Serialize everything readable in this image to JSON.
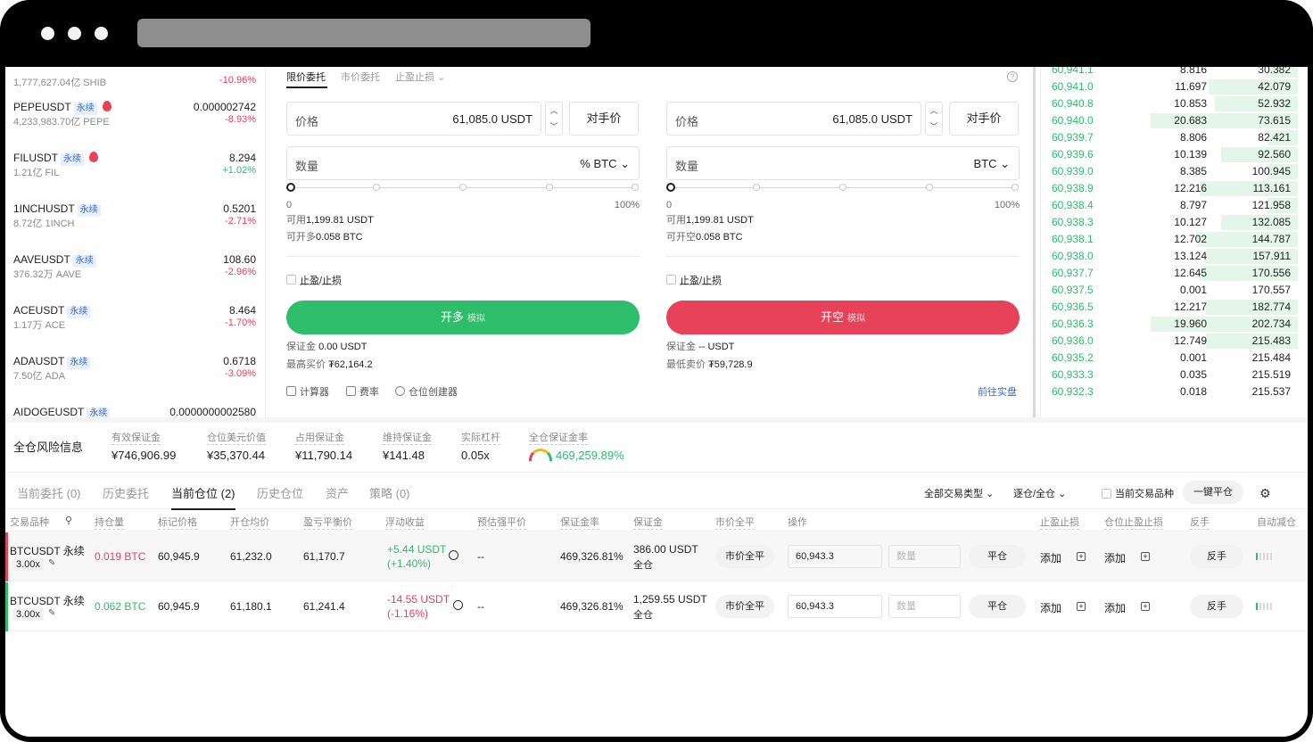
{
  "browser": {
    "dots": 3
  },
  "symbols": [
    {
      "name": "",
      "volume": "1,777,627.04亿 SHIB",
      "price": "",
      "change": "-10.96%",
      "dir": "down",
      "badge": "",
      "hot": false
    },
    {
      "name": "PEPEUSDT",
      "volume": "4,233,983.70亿 PEPE",
      "price": "0.000002742",
      "change": "-8.93%",
      "dir": "down",
      "badge": "永续",
      "hot": true
    },
    {
      "name": "FILUSDT",
      "volume": "1.21亿 FIL",
      "price": "8.294",
      "change": "+1.02%",
      "dir": "up",
      "badge": "永续",
      "hot": true
    },
    {
      "name": "1INCHUSDT",
      "volume": "8.72亿 1INCH",
      "price": "0.5201",
      "change": "-2.71%",
      "dir": "down",
      "badge": "永续",
      "hot": false
    },
    {
      "name": "AAVEUSDT",
      "volume": "376.32万 AAVE",
      "price": "108.60",
      "change": "-2.96%",
      "dir": "down",
      "badge": "永续",
      "hot": false
    },
    {
      "name": "ACEUSDT",
      "volume": "1.17万 ACE",
      "price": "8.464",
      "change": "-1.70%",
      "dir": "down",
      "badge": "永续",
      "hot": false
    },
    {
      "name": "ADAUSDT",
      "volume": "7.50亿 ADA",
      "price": "0.6718",
      "change": "-3.09%",
      "dir": "down",
      "badge": "永续",
      "hot": false
    },
    {
      "name": "AIDOGEUSDT",
      "volume": "",
      "price": "0.0000000002580",
      "change": "",
      "dir": "down",
      "badge": "永续",
      "hot": false
    }
  ],
  "trade": {
    "tabs": [
      "限价委托",
      "市价委托",
      "止盈止损"
    ],
    "help": "?",
    "long": {
      "price_label": "价格",
      "price_value": "61,085.0  USDT",
      "counter": "对手价",
      "qty_label": "数量",
      "qty_unit": "%  BTC",
      "slider_min": "0",
      "slider_max": "100%",
      "available_label": "可用",
      "available": "1,199.81 USDT",
      "openable_label": "可开多",
      "openable": "0.058 BTC",
      "tpsl": "止盈/止损",
      "button": "开多",
      "button_tag": "模拟",
      "margin_label": "保证金",
      "margin": "0.00 USDT",
      "limit_label": "最高买价",
      "limit": "₮62,164.2"
    },
    "short": {
      "price_label": "价格",
      "price_value": "61,085.0  USDT",
      "counter": "对手价",
      "qty_label": "数量",
      "qty_unit": "BTC",
      "slider_min": "0",
      "slider_max": "100%",
      "available_label": "可用",
      "available": "1,199.81 USDT",
      "openable_label": "可开空",
      "openable": "0.058 BTC",
      "tpsl": "止盈/止损",
      "button": "开空",
      "button_tag": "模拟",
      "margin_label": "保证金",
      "margin": "-- USDT",
      "limit_label": "最低卖价",
      "limit": "₮59,728.9"
    },
    "tools": [
      "计算器",
      "费率",
      "仓位创建器"
    ],
    "real_link": "前往实盘"
  },
  "orderbook": [
    {
      "price": "60,941.1",
      "qty": "8.816",
      "total": "30.382",
      "depth": 0.2
    },
    {
      "price": "60,941.0",
      "qty": "11.697",
      "total": "42.079",
      "depth": 0.58
    },
    {
      "price": "60,940.8",
      "qty": "10.853",
      "total": "52.932",
      "depth": 0.54
    },
    {
      "price": "60,940.0",
      "qty": "20.683",
      "total": "73.615",
      "depth": 0.96
    },
    {
      "price": "60,939.7",
      "qty": "8.806",
      "total": "82.421",
      "depth": 0.2
    },
    {
      "price": "60,939.6",
      "qty": "10.139",
      "total": "92.560",
      "depth": 0.5
    },
    {
      "price": "60,939.0",
      "qty": "8.385",
      "total": "100.945",
      "depth": 0.2
    },
    {
      "price": "60,938.9",
      "qty": "12.216",
      "total": "113.161",
      "depth": 0.64
    },
    {
      "price": "60,938.4",
      "qty": "8.797",
      "total": "121.958",
      "depth": 0.2
    },
    {
      "price": "60,938.3",
      "qty": "10.127",
      "total": "132.085",
      "depth": 0.5
    },
    {
      "price": "60,938.1",
      "qty": "12.702",
      "total": "144.787",
      "depth": 0.66
    },
    {
      "price": "60,938.0",
      "qty": "13.124",
      "total": "157.911",
      "depth": 0.6
    },
    {
      "price": "60,937.7",
      "qty": "12.645",
      "total": "170.556",
      "depth": 0.64
    },
    {
      "price": "60,937.5",
      "qty": "0.001",
      "total": "170.557",
      "depth": 0.0
    },
    {
      "price": "60,936.5",
      "qty": "12.217",
      "total": "182.774",
      "depth": 0.6
    },
    {
      "price": "60,936.3",
      "qty": "19.960",
      "total": "202.734",
      "depth": 0.96
    },
    {
      "price": "60,936.0",
      "qty": "12.749",
      "total": "215.483",
      "depth": 0.6
    },
    {
      "price": "60,935.2",
      "qty": "0.001",
      "total": "215.484",
      "depth": 0.0
    },
    {
      "price": "60,933.3",
      "qty": "0.035",
      "total": "215.519",
      "depth": 0.0
    },
    {
      "price": "60,932.3",
      "qty": "0.018",
      "total": "215.537",
      "depth": 0.0
    }
  ],
  "risk": {
    "title": "全仓风险信息",
    "metrics": [
      {
        "label": "有效保证金",
        "value": "¥746,906.99"
      },
      {
        "label": "仓位美元价值",
        "value": "¥35,370.44"
      },
      {
        "label": "占用保证金",
        "value": "¥11,790.14"
      },
      {
        "label": "维持保证金",
        "value": "¥141.48"
      },
      {
        "label": "实际杠杆",
        "value": "0.05x"
      },
      {
        "label": "全仓保证金率",
        "value": "469,259.89%"
      }
    ]
  },
  "position_tabs": [
    "当前委托 (0)",
    "历史委托",
    "当前仓位 (2)",
    "历史仓位",
    "资产",
    "策略 (0)"
  ],
  "filters": {
    "type": "全部交易类型",
    "mode": "逐仓/全仓",
    "current_only": "当前交易品种",
    "close_all": "一键平仓"
  },
  "columns": [
    "交易品种",
    "持仓量",
    "标记价格",
    "开仓均价",
    "盈亏平衡价",
    "浮动收益",
    "预估强平价",
    "保证金率",
    "保证金",
    "市价全平",
    "操作",
    "止盈止损",
    "仓位止盈止损",
    "反手",
    "自动减仓"
  ],
  "positions": [
    {
      "symbol": "BTCUSDT 永续",
      "leverage": "3.00x",
      "size": "0.019 BTC",
      "side": "short",
      "mark": "60,945.9",
      "entry": "61,232.0",
      "breakeven": "61,170.7",
      "pnl": "+5.44 USDT",
      "pnl_pct": "(+1.40%)",
      "pnl_dir": "up",
      "liq": "--",
      "margin_ratio": "469,326.81%",
      "margin": "386.00 USDT",
      "margin_mode": "全仓",
      "market_close": "市价全平",
      "price_input": "60,943.3",
      "qty_placeholder": "数量",
      "close": "平仓",
      "tpsl": "添加",
      "pos_tpsl": "添加",
      "reverse": "反手"
    },
    {
      "symbol": "BTCUSDT 永续",
      "leverage": "3.00x",
      "size": "0.062 BTC",
      "side": "long",
      "mark": "60,945.9",
      "entry": "61,180.1",
      "breakeven": "61,241.4",
      "pnl": "-14.55 USDT",
      "pnl_pct": "(-1.16%)",
      "pnl_dir": "down",
      "liq": "--",
      "margin_ratio": "469,326.81%",
      "margin": "1,259.55 USDT",
      "margin_mode": "全仓",
      "market_close": "市价全平",
      "price_input": "60,943.3",
      "qty_placeholder": "数量",
      "close": "平仓",
      "tpsl": "添加",
      "pos_tpsl": "添加",
      "reverse": "反手"
    }
  ],
  "colors": {
    "up": "#2ebd6b",
    "down": "#e8415a",
    "long": "#2ebd6b",
    "short": "#e8415a",
    "link": "#2f6bd8"
  }
}
